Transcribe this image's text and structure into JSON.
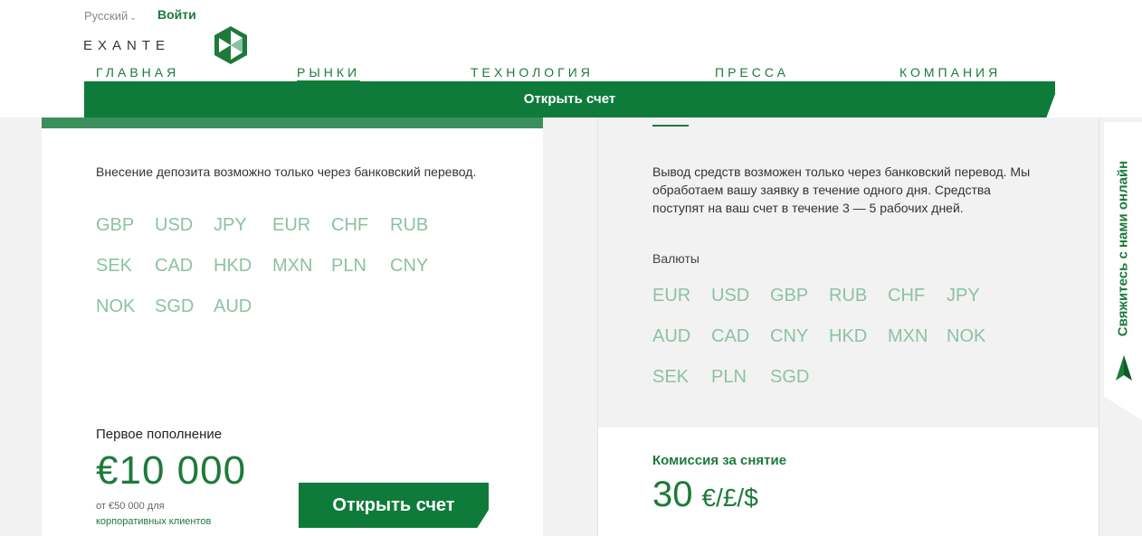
{
  "header": {
    "language": "Русский",
    "login": "Войти",
    "brand": "EXANTE",
    "nav": [
      {
        "label": "ГЛАВНАЯ"
      },
      {
        "label": "РЫНКИ"
      },
      {
        "label": "ТЕХНОЛОГИЯ"
      },
      {
        "label": "ПРЕССА"
      },
      {
        "label": "КОМПАНИЯ"
      }
    ],
    "active_nav": "РЫНКИ",
    "open_account": "Открыть счет"
  },
  "deposit": {
    "description": "Внесение депозита возможно только через банковский перевод.",
    "currencies": [
      "GBP",
      "USD",
      "JPY",
      "EUR",
      "CHF",
      "RUB",
      "SEK",
      "CAD",
      "HKD",
      "MXN",
      "PLN",
      "CNY",
      "NOK",
      "SGD",
      "AUD"
    ],
    "first_label": "Первое пополнение",
    "first_amount": "€10 000",
    "corp_prefix": "от €50 000 для",
    "corp_link": "корпоративных клиентов",
    "open_button": "Открыть счет"
  },
  "withdrawal": {
    "description": "Вывод средств возможен только через банковский перевод. Мы обработаем вашу заявку в течение одного дня. Средства поступят на ваш счет в течение 3 — 5 рабочих дней.",
    "currencies_label": "Валюты",
    "currencies": [
      "EUR",
      "USD",
      "GBP",
      "RUB",
      "CHF",
      "JPY",
      "AUD",
      "CAD",
      "CNY",
      "HKD",
      "MXN",
      "NOK",
      "SEK",
      "PLN",
      "SGD"
    ],
    "fee_label": "Комиссия за снятие",
    "fee_amount": "30",
    "fee_currency": "€/£/$"
  },
  "side_tab": {
    "label": "Свяжитесь с нами онлайн"
  },
  "colors": {
    "brand_green": "#0f7b3a",
    "accent_green": "#1e7a3a",
    "currency_green": "#8cc2a3"
  }
}
